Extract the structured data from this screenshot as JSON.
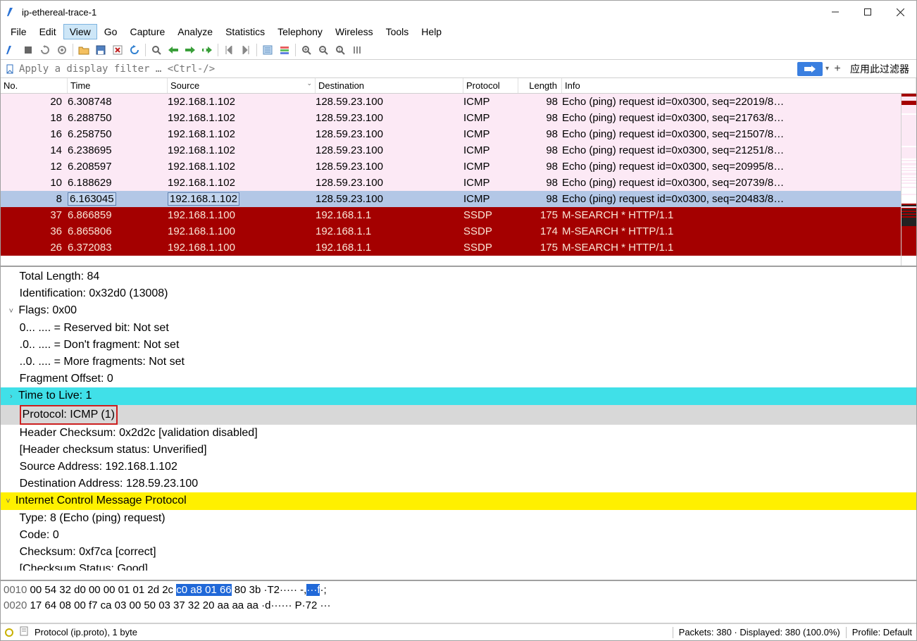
{
  "window": {
    "title": "ip-ethereal-trace-1"
  },
  "menu": {
    "items": [
      "File",
      "Edit",
      "View",
      "Go",
      "Capture",
      "Analyze",
      "Statistics",
      "Telephony",
      "Wireless",
      "Tools",
      "Help"
    ],
    "active_index": 2
  },
  "filter": {
    "placeholder": "Apply a display filter … <Ctrl-/>",
    "apply_label": "应用此过滤器"
  },
  "columns": {
    "no": "No.",
    "time": "Time",
    "source": "Source",
    "destination": "Destination",
    "protocol": "Protocol",
    "length": "Length",
    "info": "Info"
  },
  "packets": [
    {
      "no": "20",
      "time": "6.308748",
      "src": "192.168.1.102",
      "dst": "128.59.23.100",
      "proto": "ICMP",
      "len": "98",
      "info": "Echo (ping) request  id=0x0300, seq=22019/8…",
      "cls": "pink"
    },
    {
      "no": "18",
      "time": "6.288750",
      "src": "192.168.1.102",
      "dst": "128.59.23.100",
      "proto": "ICMP",
      "len": "98",
      "info": "Echo (ping) request  id=0x0300, seq=21763/8…",
      "cls": "pink"
    },
    {
      "no": "16",
      "time": "6.258750",
      "src": "192.168.1.102",
      "dst": "128.59.23.100",
      "proto": "ICMP",
      "len": "98",
      "info": "Echo (ping) request  id=0x0300, seq=21507/8…",
      "cls": "pink"
    },
    {
      "no": "14",
      "time": "6.238695",
      "src": "192.168.1.102",
      "dst": "128.59.23.100",
      "proto": "ICMP",
      "len": "98",
      "info": "Echo (ping) request  id=0x0300, seq=21251/8…",
      "cls": "pink"
    },
    {
      "no": "12",
      "time": "6.208597",
      "src": "192.168.1.102",
      "dst": "128.59.23.100",
      "proto": "ICMP",
      "len": "98",
      "info": "Echo (ping) request  id=0x0300, seq=20995/8…",
      "cls": "pink"
    },
    {
      "no": "10",
      "time": "6.188629",
      "src": "192.168.1.102",
      "dst": "128.59.23.100",
      "proto": "ICMP",
      "len": "98",
      "info": "Echo (ping) request  id=0x0300, seq=20739/8…",
      "cls": "pink"
    },
    {
      "no": "8",
      "time": "6.163045",
      "src": "192.168.1.102",
      "dst": "128.59.23.100",
      "proto": "ICMP",
      "len": "98",
      "info": "Echo (ping) request  id=0x0300, seq=20483/8…",
      "cls": "sel"
    },
    {
      "no": "37",
      "time": "6.866859",
      "src": "192.168.1.100",
      "dst": "192.168.1.1",
      "proto": "SSDP",
      "len": "175",
      "info": "M-SEARCH * HTTP/1.1",
      "cls": "red"
    },
    {
      "no": "36",
      "time": "6.865806",
      "src": "192.168.1.100",
      "dst": "192.168.1.1",
      "proto": "SSDP",
      "len": "174",
      "info": "M-SEARCH * HTTP/1.1",
      "cls": "red"
    },
    {
      "no": "26",
      "time": "6.372083",
      "src": "192.168.1.100",
      "dst": "192.168.1.1",
      "proto": "SSDP",
      "len": "175",
      "info": "M-SEARCH * HTTP/1.1",
      "cls": "red"
    }
  ],
  "details": {
    "lines": [
      {
        "indent": 3,
        "text": "Total Length: 84"
      },
      {
        "indent": 3,
        "text": "Identification: 0x32d0 (13008)"
      },
      {
        "indent": 2,
        "caret": "v",
        "text": "Flags: 0x00"
      },
      {
        "indent": 4,
        "text": "0... .... = Reserved bit: Not set"
      },
      {
        "indent": 4,
        "text": ".0.. .... = Don't fragment: Not set"
      },
      {
        "indent": 4,
        "text": "..0. .... = More fragments: Not set"
      },
      {
        "indent": 3,
        "text": "Fragment Offset: 0"
      },
      {
        "indent": 2,
        "caret": ">",
        "text": "Time to Live: 1",
        "hl": "cyan"
      },
      {
        "indent": 3,
        "text": "Protocol: ICMP (1)",
        "redbox": true,
        "hl": "grey"
      },
      {
        "indent": 3,
        "text": "Header Checksum: 0x2d2c [validation disabled]"
      },
      {
        "indent": 3,
        "text": "[Header checksum status: Unverified]"
      },
      {
        "indent": 3,
        "text": "Source Address: 192.168.1.102"
      },
      {
        "indent": 3,
        "text": "Destination Address: 128.59.23.100"
      },
      {
        "indent": 1,
        "caret": "v",
        "text": "Internet Control Message Protocol",
        "hl": "yellow"
      },
      {
        "indent": 3,
        "text": "Type: 8 (Echo (ping) request)"
      },
      {
        "indent": 3,
        "text": "Code: 0"
      },
      {
        "indent": 3,
        "text": "Checksum: 0xf7ca [correct]"
      },
      {
        "indent": 3,
        "text": "[Checksum Status: Good]",
        "cut": true
      }
    ]
  },
  "hex": {
    "rows": [
      {
        "off": "0010",
        "b1": "00 54 32 d0 00 00 01 01",
        "b2a": "2d 2c ",
        "b2hl": "c0 a8 01 66",
        "b2b": " 80 3b",
        "a1": "·T2····· -,",
        "a1hl": "···f",
        "a2": "·;"
      },
      {
        "off": "0020",
        "b1": "17 64 08 00 f7 ca 03 00",
        "b2a": "50 03 37 32 20 aa aa aa",
        "b2hl": "",
        "b2b": "",
        "a1": "·d······ P·72 ···",
        "a1hl": "",
        "a2": ""
      }
    ]
  },
  "status": {
    "field": "Protocol (ip.proto), 1 byte",
    "packets_label": "Packets: 380",
    "displayed_label": "Displayed: 380 (100.0%)",
    "profile_label": "Profile: Default"
  },
  "minimap": [
    "red",
    "red",
    "pink",
    "pink",
    "pink",
    "red",
    "red",
    "red",
    "pink",
    "pink",
    "pink",
    "pink",
    "pink",
    "pink",
    "white",
    "pink",
    "pink",
    "pink",
    "pink",
    "pink",
    "pink",
    "pink",
    "pink",
    "pink",
    "pink",
    "pink",
    "pink",
    "pink",
    "pink",
    "pink",
    "pink",
    "pink",
    "pink",
    "pink",
    "pink",
    "pink",
    "pink",
    "white",
    "pink",
    "pink",
    "pink",
    "pink",
    "pink",
    "pink",
    "pink",
    "pink",
    "white",
    "pink",
    "white",
    "pink",
    "pink",
    "white",
    "pink",
    "white",
    "pink",
    "white",
    "pink",
    "pink",
    "white",
    "pink",
    "white",
    "pink",
    "white",
    "pink",
    "white",
    "white",
    "pink",
    "white",
    "white",
    "white",
    "white",
    "pink",
    "white",
    "white",
    "white",
    "white",
    "white",
    "white",
    "red",
    "dark",
    "pink",
    "red",
    "dark",
    "red",
    "dark",
    "red",
    "dark",
    "red",
    "dark",
    "dark",
    "dark",
    "dark",
    "dark",
    "dark"
  ]
}
